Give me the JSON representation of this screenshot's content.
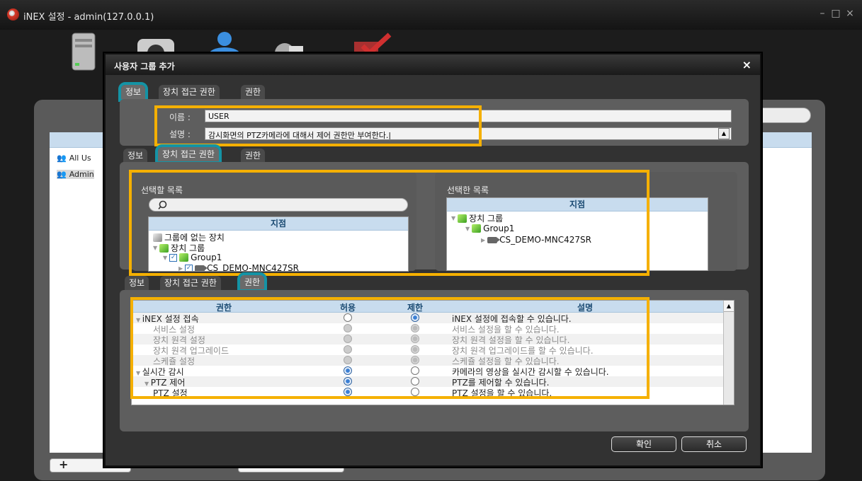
{
  "window": {
    "title": "iNEX 설정 - admin(127.0.0.1)",
    "min": "–",
    "max": "□",
    "close": "×"
  },
  "background": {
    "user_groups": [
      "All Us",
      "Admin"
    ],
    "add_label": "+",
    "remove_label": "–"
  },
  "dialog": {
    "title": "사용자 그룹 추가",
    "close": "×",
    "tabs": [
      "정보",
      "장치 접근 권한",
      "권한"
    ],
    "info": {
      "name_label": "이름 :",
      "name_value": "USER",
      "desc_label": "설명 :",
      "desc_value": "감시화면의 PTZ카메라에 대해서 제어 권한만 부여한다.|"
    },
    "device_access": {
      "available_title": "선택할 목록",
      "selected_title": "선택한 목록",
      "column": "지점",
      "available_tree": [
        "그룹에 없는 장치",
        "장치 그룹",
        "Group1",
        "CS_DEMO-MNC427SR"
      ],
      "selected_tree": [
        "장치 그룹",
        "Group1",
        "CS_DEMO-MNC427SR"
      ]
    },
    "permissions": {
      "columns": [
        "권한",
        "허용",
        "제한",
        "설명"
      ],
      "rows": [
        {
          "name": "iNEX 설정 접속",
          "allow": false,
          "deny": true,
          "desc": "iNEX 설정에 접속할 수 있습니다."
        },
        {
          "name": "서비스 설정",
          "allow": false,
          "deny": true,
          "desc": "서비스 설정을 할 수 있습니다."
        },
        {
          "name": "장치 원격 설정",
          "allow": false,
          "deny": true,
          "desc": "장치 원격 설정을 할 수 있습니다."
        },
        {
          "name": "장치 원격 업그레이드",
          "allow": false,
          "deny": true,
          "desc": "장치 원격 업그레이드를 할 수 있습니다."
        },
        {
          "name": "스케쥴 설정",
          "allow": false,
          "deny": true,
          "desc": "스케쥴 설정을 할 수 있습니다."
        },
        {
          "name": "실시간 감시",
          "allow": true,
          "deny": false,
          "desc": "카메라의 영상을 실시간 감시할 수 있습니다."
        },
        {
          "name": "PTZ 제어",
          "allow": true,
          "deny": false,
          "desc": "PTZ를 제어할 수 있습니다."
        },
        {
          "name": "PTZ 설정",
          "allow": true,
          "deny": false,
          "desc": "PTZ 설정을 할 수 있습니다."
        }
      ]
    },
    "ok": "확인",
    "cancel": "취소"
  },
  "colors": {
    "highlight": "#f5b000",
    "tab_outline": "#1493a5"
  }
}
